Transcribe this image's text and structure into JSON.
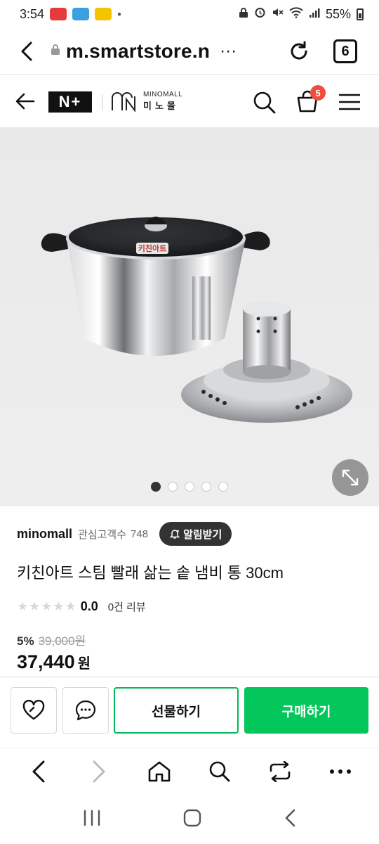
{
  "status_bar": {
    "time": "3:54",
    "battery": "55%",
    "icons": [
      "notification-app-icon",
      "notification-app-icon",
      "notification-app-icon",
      "lock-icon",
      "alarm-icon",
      "mute-icon",
      "wifi-icon",
      "signal-icon",
      "battery-icon"
    ]
  },
  "browser": {
    "url": "m.smartstore.n",
    "more": "···",
    "tab_count": "6"
  },
  "store_header": {
    "nplus": "N+",
    "brand_mark": "MN",
    "brand_name_en": "MINOMALL",
    "brand_name_ko": "미노몰",
    "cart_badge": "5"
  },
  "product_image": {
    "total_images": 5,
    "active_index": 0,
    "photo_label": "키친아트"
  },
  "product": {
    "seller": "minomall",
    "follow_label": "관심고객수",
    "follow_count": "748",
    "alert_label": "알림받기",
    "title": "키친아트 스팀 빨래 삶는 솥 냄비 통 30cm",
    "rating": "0.0",
    "rating_stars": 0,
    "review_count": "0건 리뷰",
    "discount": "5%",
    "original_price": "39,000원",
    "price": "37,440",
    "currency": "원"
  },
  "actions": {
    "gift_label": "선물하기",
    "buy_label": "구매하기"
  },
  "colors": {
    "naver_green": "#03c75a",
    "badge_red": "#f04e3b",
    "dark": "#333333"
  }
}
